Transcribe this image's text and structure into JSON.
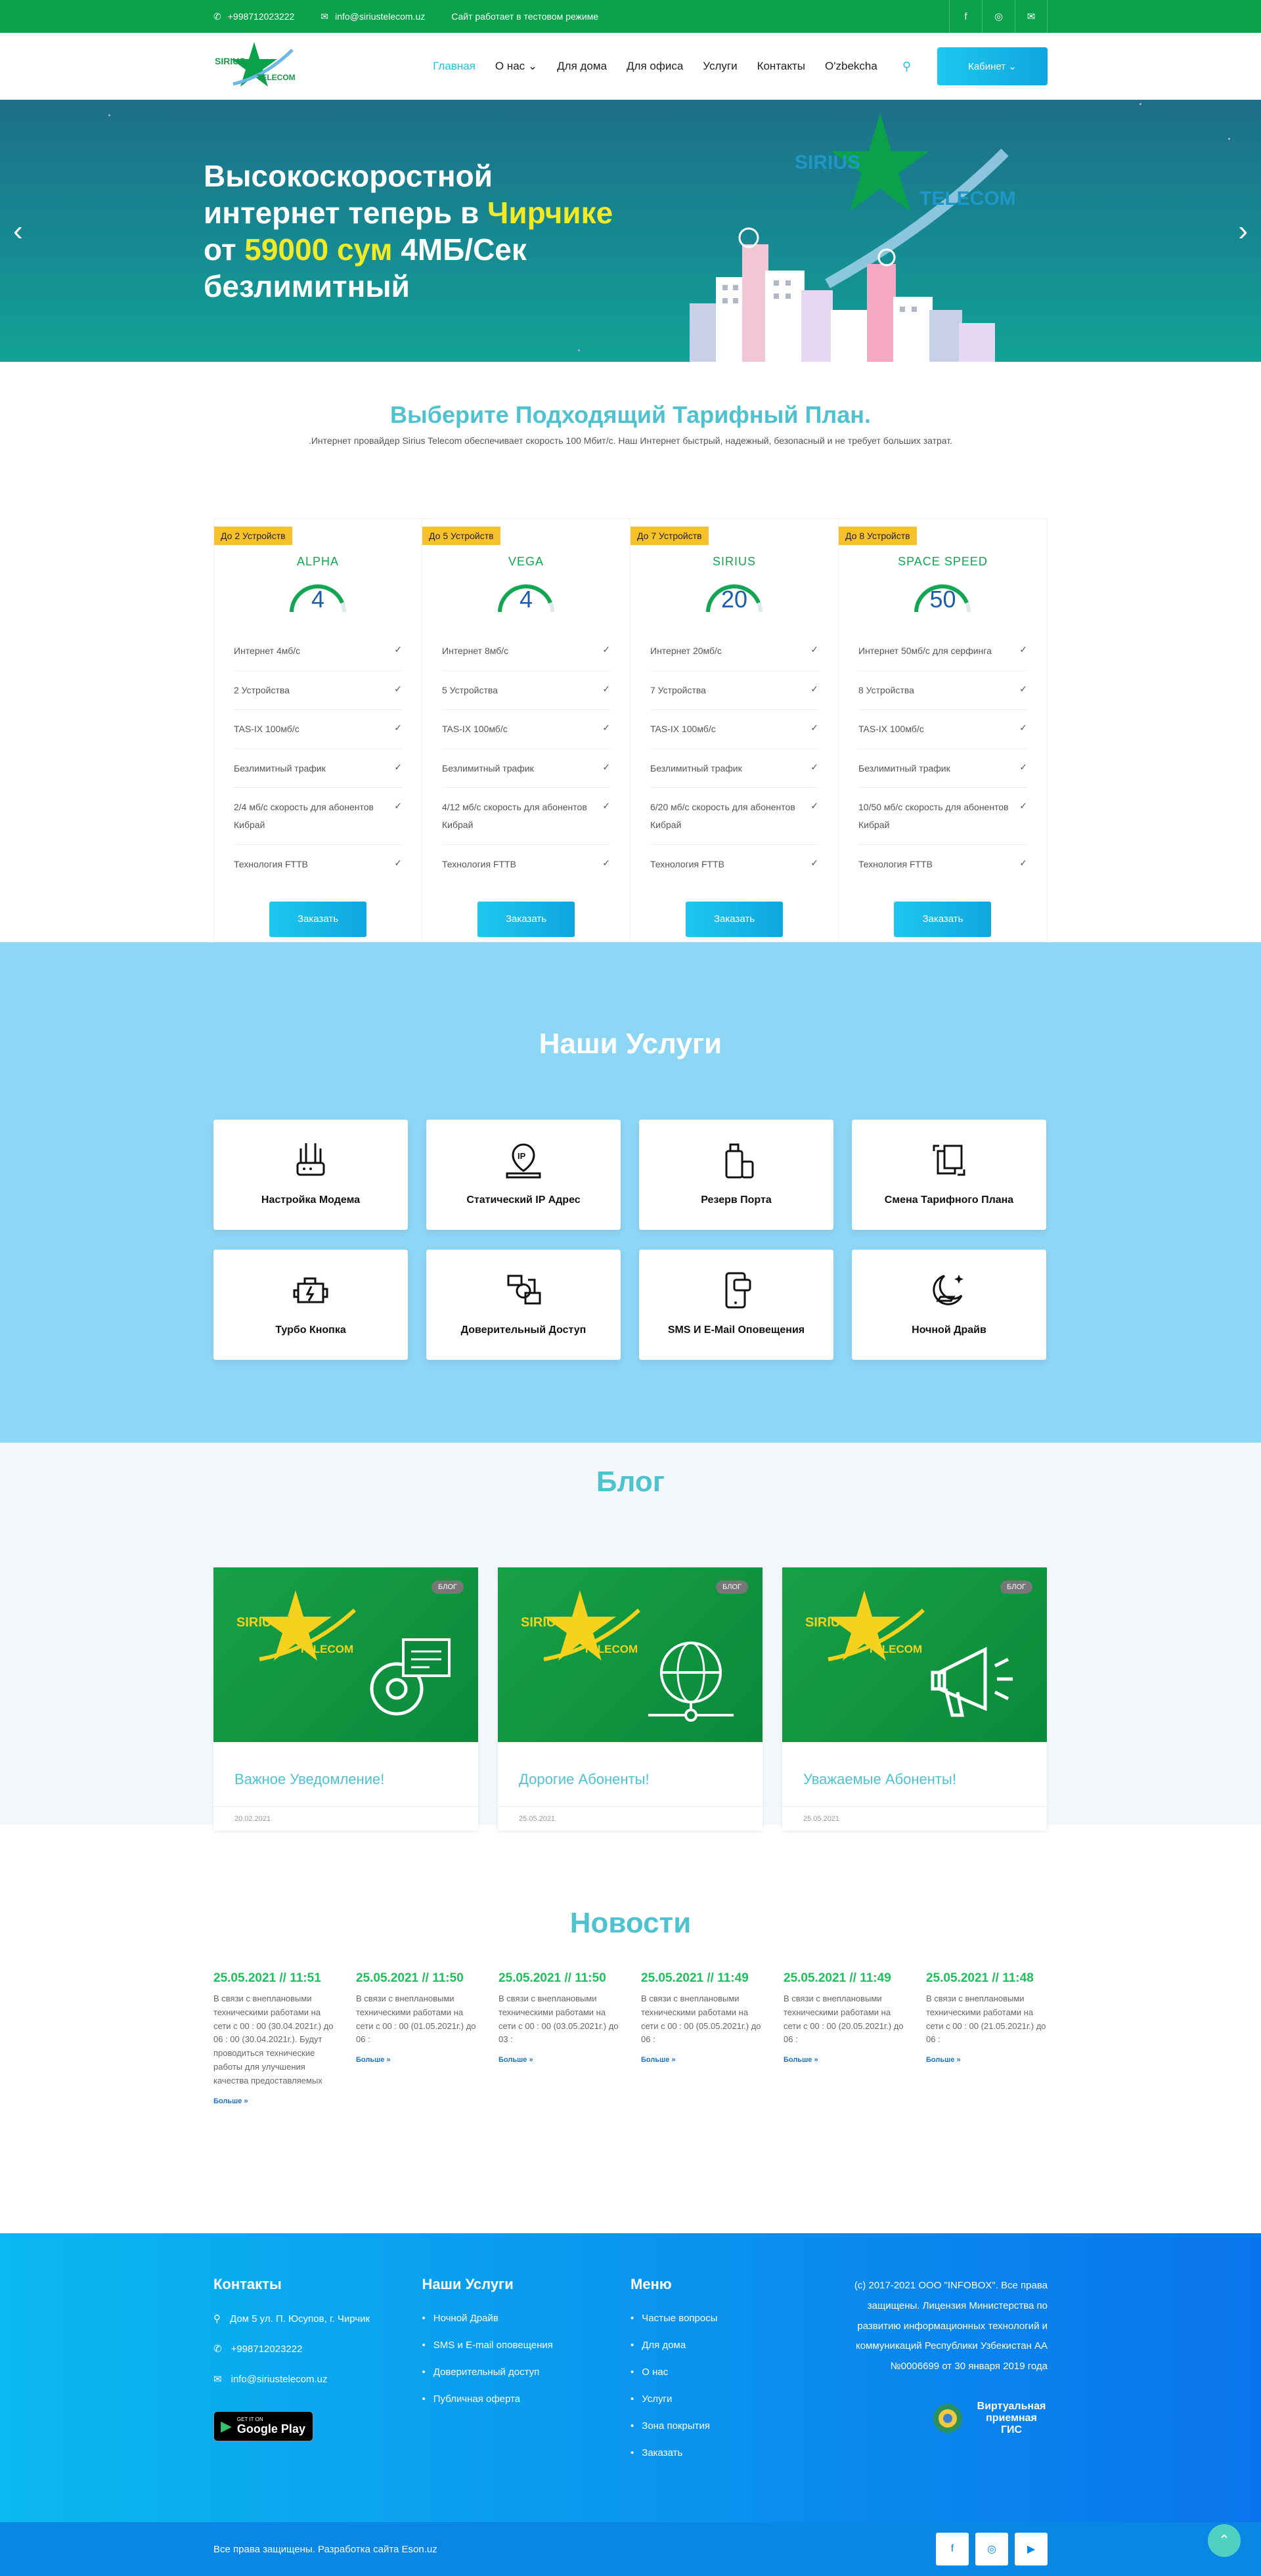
{
  "topbar": {
    "phone": "+998712023222",
    "email": "info@siriustelecom.uz",
    "notice": "Сайт работает в тестовом режиме",
    "social": [
      "f",
      "◎",
      "✉"
    ]
  },
  "brand": {
    "line1": "SIRIUS",
    "line2": "TELECOM",
    "color": "#0aa14b"
  },
  "nav": {
    "items": [
      "Главная",
      "О нас ⌄",
      "Для дома",
      "Для офиса",
      "Услуги",
      "Контакты",
      "O'zbekcha"
    ],
    "cabinet": "Кабинет ⌄"
  },
  "hero": {
    "l1": "Высокоскоростной",
    "l2a": "интернет теперь в ",
    "l2b": "Чирчике",
    "l3a": "от ",
    "l3b": "59000 сум",
    "l3c": " 4МБ/Сек",
    "l4": "безлимитный"
  },
  "pricing": {
    "title": "Выберите Подходящий Тарифный План.",
    "subtitle": ".Интернет провайдер Sirius Telecom обеспечивает скорость 100 Мбит/с. Наш Интернет быстрый, надежный, безопасный и не требует больших затрат.",
    "order_label": "Заказать",
    "plans": [
      {
        "devices": "До 2 Устройств",
        "name": "ALPHA",
        "speed": "4",
        "features": [
          "Интернет 4мб/с",
          "2 Устройства",
          "TAS-IX 100мб/с",
          "Безлимитный трафик",
          "2/4 мб/с скорость для абонентов Кибрай",
          "Технология FTTB"
        ]
      },
      {
        "devices": "До 5 Устройств",
        "name": "VEGA",
        "speed": "4",
        "features": [
          "Интернет 8мб/с",
          "5 Устройства",
          "TAS-IX 100мб/с",
          "Безлимитный трафик",
          "4/12 мб/с скорость для абонентов Кибрай",
          "Технология FTTB"
        ]
      },
      {
        "devices": "До 7 Устройств",
        "name": "SIRIUS",
        "speed": "20",
        "features": [
          "Интернет 20мб/с",
          "7 Устройства",
          "TAS-IX 100мб/с",
          "Безлимитный трафик",
          "6/20 мб/с скорость для абонентов Кибрай",
          "Технология FTTB"
        ]
      },
      {
        "devices": "До 8 Устройств",
        "name": "SPACE SPEED",
        "speed": "50",
        "features": [
          "Интернет 50мб/с для серфинга",
          "8 Устройства",
          "TAS-IX 100мб/с",
          "Безлимитный трафик",
          "10/50 мб/с скорость для абонентов Кибрай",
          "Технология FTTB"
        ]
      }
    ]
  },
  "services": {
    "title": "Наши Услуги",
    "items": [
      {
        "label": "Настройка Модема",
        "icon": "modem-icon"
      },
      {
        "label": "Статический IP Адрес",
        "icon": "ip-address-icon"
      },
      {
        "label": "Резерв Порта",
        "icon": "luggage-icon"
      },
      {
        "label": "Смена Тарифного Плана",
        "icon": "document-swap-icon"
      },
      {
        "label": "Турбо Кнопка",
        "icon": "engine-icon"
      },
      {
        "label": "Доверительный Доступ",
        "icon": "trust-access-icon"
      },
      {
        "label": "SMS И E-Mail Оповещения",
        "icon": "phone-message-icon"
      },
      {
        "label": "Ночной Драйв",
        "icon": "night-drive-icon"
      }
    ]
  },
  "blog": {
    "title": "Блог",
    "badge": "БЛОГ",
    "posts": [
      {
        "title": "Важное Уведомление!",
        "date": "20.02.2021",
        "icon": "gear-document-icon"
      },
      {
        "title": "Дорогие Абоненты!",
        "date": "25.05.2021",
        "icon": "globe-network-icon"
      },
      {
        "title": "Уважаемые Абоненты!",
        "date": "25.05.2021",
        "icon": "megaphone-icon"
      }
    ]
  },
  "news": {
    "title": "Новости",
    "more": "Больше »",
    "items": [
      {
        "date": "25.05.2021 // 11:51",
        "text": "В связи с внеплановыми техническими работами на сети с 00 : 00 (30.04.2021г.) до 06 : 00 (30.04.2021г.). Будут проводиться технические работы для улучшения качества предоставляемых"
      },
      {
        "date": "25.05.2021 // 11:50",
        "text": "В связи с внеплановыми техническими работами на сети с 00 : 00 (01.05.2021г.) до 06 :"
      },
      {
        "date": "25.05.2021 // 11:50",
        "text": "В связи с внеплановыми техническими работами на сети с 00 : 00 (03.05.2021г.) до 03 :"
      },
      {
        "date": "25.05.2021 // 11:49",
        "text": "В связи с внеплановыми техническими работами на сети с 00 : 00 (05.05.2021г.) до 06 :"
      },
      {
        "date": "25.05.2021 // 11:49",
        "text": "В связи с внеплановыми техническими работами на сети с 00 : 00 (20.05.2021г.) до 06 :"
      },
      {
        "date": "25.05.2021 // 11:48",
        "text": "В связи с внеплановыми техническими работами на сети с 00 : 00 (21.05.2021г.) до 06 :"
      }
    ]
  },
  "footer": {
    "contacts_title": "Контакты",
    "address": "Дом 5 ул. П. Юсупов, г. Чирчик",
    "phone": "+998712023222",
    "email": "info@siriustelecom.uz",
    "gplay_top": "GET IT ON",
    "gplay_bottom": "Google Play",
    "services_title": "Наши Услуги",
    "services": [
      "Ночной Драйв",
      "SMS и E-mail оповещения",
      "Доверительный доступ",
      "Публичная оферта"
    ],
    "menu_title": "Меню",
    "menu": [
      "Частые вопросы",
      "Для дома",
      "О нас",
      "Услуги",
      "Зона покрытия",
      "Заказать"
    ],
    "license": "(c) 2017-2021 ООО \"INFOBOX\". Все права защищены. Лицензия Министерства по развитию информационных технологий и коммуникаций Республики Узбекистан АА №0006699 от 30 января 2019 года",
    "gis": "Виртуальная приемная ГИС",
    "copyright": "Все права защищены. Разработка сайта Eson.uz",
    "social": [
      "f",
      "◎",
      "▶"
    ]
  }
}
